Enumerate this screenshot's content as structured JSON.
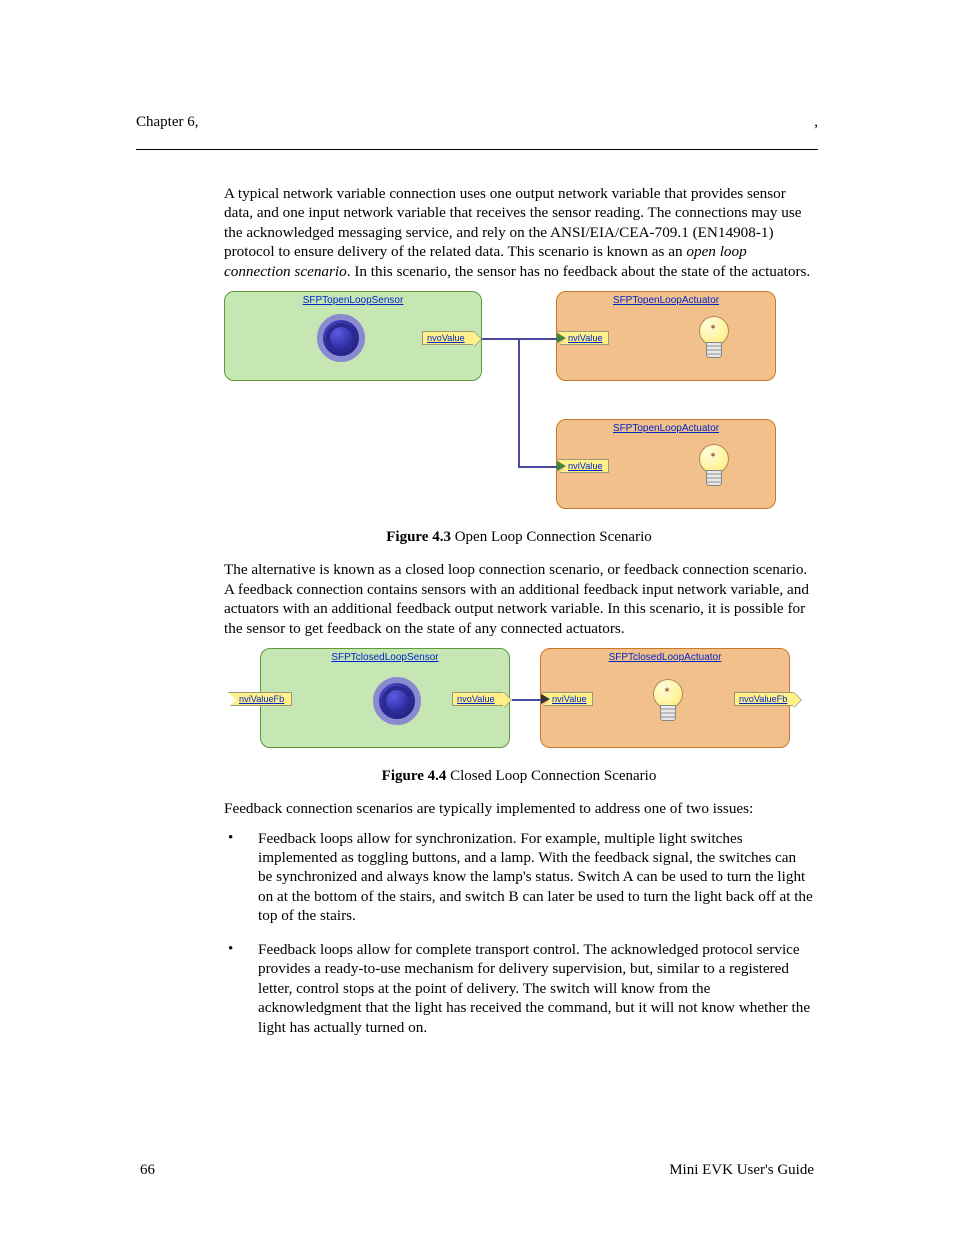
{
  "header": {
    "chapter": "Chapter 6,",
    "right": ","
  },
  "para1_a": "A typical network variable connection uses one output network variable that provides sensor data, and one input network variable that receives the sensor reading. The connections may use the acknowledged messaging service, and rely on the ANSI/EIA/CEA-709.1 (EN14908-1) protocol to ensure delivery of the related data. This scenario is known as an ",
  "para1_italic": "open loop connection scenario",
  "para1_b": ".  In this scenario, the sensor has no feedback about the state of the actuators.",
  "fig43": {
    "caption_num": "Figure 4.3",
    "caption_text": " Open Loop Connection Scenario",
    "sensor_title": "SFPTopenLoopSensor",
    "actuator_title": "SFPTopenLoopActuator",
    "nvoValue": "nvoValue",
    "nviValue": "nviValue"
  },
  "para2": "The alternative is known as a closed loop connection scenario, or feedback connection scenario. A feedback connection contains sensors with an additional feedback input network variable, and actuators with an additional feedback output network variable.  In this scenario, it is possible for the sensor to get feedback on the state of any connected actuators.",
  "fig44": {
    "caption_num": "Figure 4.4",
    "caption_text": " Closed Loop Connection Scenario",
    "sensor_title": "SFPTclosedLoopSensor",
    "actuator_title": "SFPTclosedLoopActuator",
    "nviValueFb": "nviValueFb",
    "nvoValue": "nvoValue",
    "nviValue": "nviValue",
    "nvoValueFb": "nvoValueFb"
  },
  "para3": "Feedback connection scenarios are typically implemented to address one of two issues:",
  "bullets": [
    "Feedback loops allow for synchronization.  For example, multiple light switches implemented as toggling buttons, and a lamp.  With the feedback signal, the switches can be synchronized and always know the lamp's status. Switch A can be used to turn the light on at the bottom of the stairs, and switch B can later be used to turn the light back off at the top of the stairs.",
    "Feedback loops allow for complete transport control.  The acknowledged protocol service provides a ready-to-use mechanism for delivery supervision, but, similar to a registered letter, control stops at the point of delivery.  The switch will know from the acknowledgment that the light has received the command, but it will not know whether the light has actually turned on."
  ],
  "footer": {
    "page": "66",
    "title": "Mini EVK User's Guide"
  }
}
